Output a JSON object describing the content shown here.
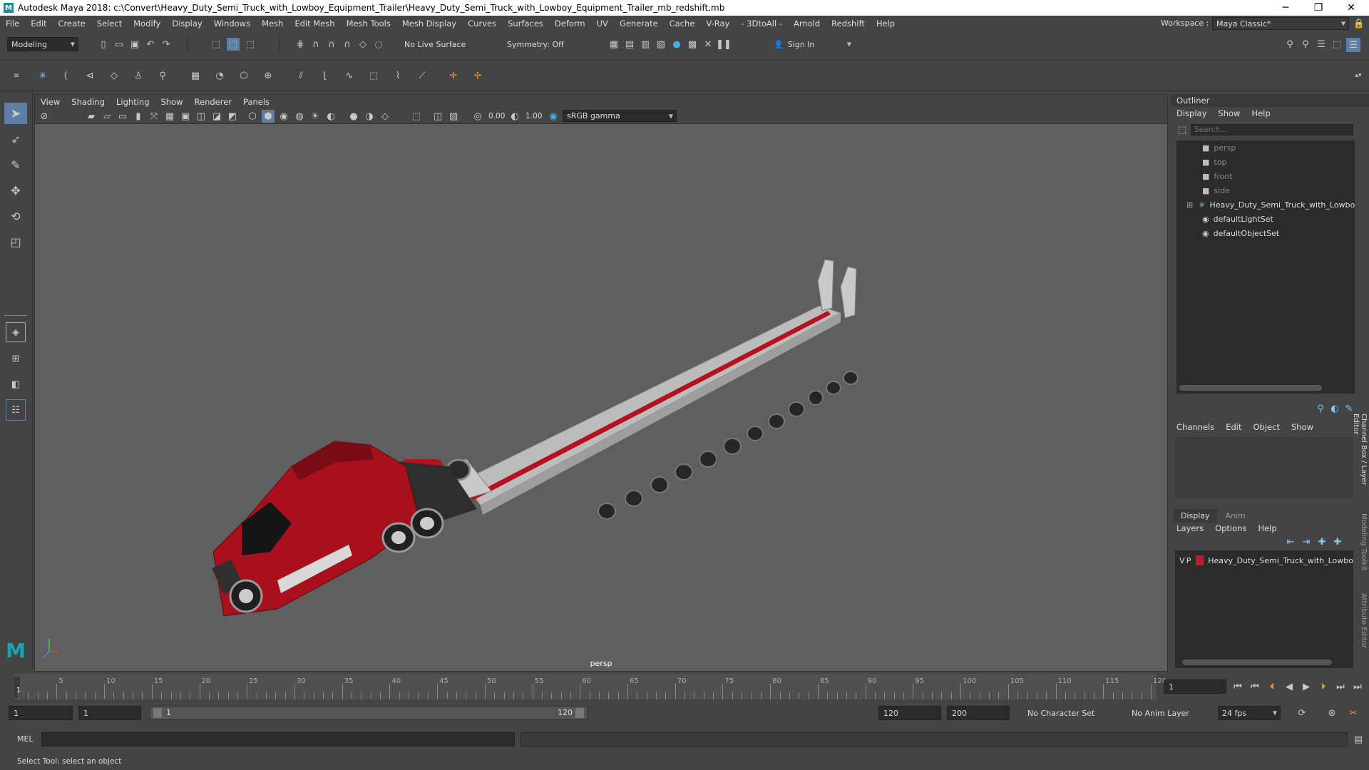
{
  "title_bar": {
    "logo": "M",
    "title": "Autodesk Maya 2018: c:\\Convert\\Heavy_Duty_Semi_Truck_with_Lowboy_Equipment_Trailer\\Heavy_Duty_Semi_Truck_with_Lowboy_Equipment_Trailer_mb_redshift.mb",
    "minimize": "─",
    "maximize": "❐",
    "close": "✕"
  },
  "menu": [
    "File",
    "Edit",
    "Create",
    "Select",
    "Modify",
    "Display",
    "Windows",
    "Mesh",
    "Edit Mesh",
    "Mesh Tools",
    "Mesh Display",
    "Curves",
    "Surfaces",
    "Deform",
    "UV",
    "Generate",
    "Cache",
    "V-Ray",
    "- 3DtoAll -",
    "Arnold",
    "Redshift",
    "Help"
  ],
  "workspace": {
    "label": "Workspace :",
    "value": "Maya Classic*"
  },
  "status_line": {
    "mode": "Modeling",
    "live_surface": "No Live Surface",
    "symmetry": "Symmetry: Off",
    "sign_in": "Sign In"
  },
  "viewport": {
    "menus": [
      "View",
      "Shading",
      "Lighting",
      "Show",
      "Renderer",
      "Panels"
    ],
    "exposure": "0.00",
    "gamma": "1.00",
    "color_space": "sRGB gamma",
    "camera": "persp"
  },
  "outliner": {
    "title": "Outliner",
    "menus": [
      "Display",
      "Show",
      "Help"
    ],
    "search_placeholder": "Search...",
    "items": [
      {
        "label": "persp",
        "type": "camera"
      },
      {
        "label": "top",
        "type": "camera"
      },
      {
        "label": "front",
        "type": "camera"
      },
      {
        "label": "side",
        "type": "camera"
      },
      {
        "label": "Heavy_Duty_Semi_Truck_with_Lowboy_E",
        "type": "group"
      },
      {
        "label": "defaultLightSet",
        "type": "set"
      },
      {
        "label": "defaultObjectSet",
        "type": "set"
      }
    ]
  },
  "channel_box": {
    "menus": [
      "Channels",
      "Edit",
      "Object",
      "Show"
    ]
  },
  "layer_editor": {
    "tabs": [
      "Display",
      "Anim"
    ],
    "menus": [
      "Layers",
      "Options",
      "Help"
    ],
    "layer": {
      "v": "V",
      "p": "P",
      "name": "Heavy_Duty_Semi_Truck_with_Lowbo",
      "color": "#c0182c"
    }
  },
  "side_tabs": [
    "Channel Box / Layer Editor",
    "Modeling Toolkit",
    "Attribute Editor"
  ],
  "timeline": {
    "ticks": [
      "5",
      "10",
      "15",
      "20",
      "25",
      "30",
      "35",
      "40",
      "45",
      "50",
      "55",
      "60",
      "65",
      "70",
      "75",
      "80",
      "85",
      "90",
      "95",
      "100",
      "105",
      "110",
      "115",
      "120"
    ],
    "current_marker": "1",
    "current_frame": "1"
  },
  "range": {
    "start": "1",
    "playback_start": "1",
    "slider_start": "1",
    "slider_end": "120",
    "playback_end": "120",
    "end": "200",
    "character_set": "No Character Set",
    "anim_layer": "No Anim Layer",
    "fps": "24 fps"
  },
  "command_line": {
    "label": "MEL"
  },
  "help_line": "Select Tool: select an object",
  "colors": {
    "truck_red": "#a8101c",
    "trailer_grey": "#bdbdbd",
    "ui_bg": "#444444",
    "viewport_bg": "#5f5f5f"
  }
}
